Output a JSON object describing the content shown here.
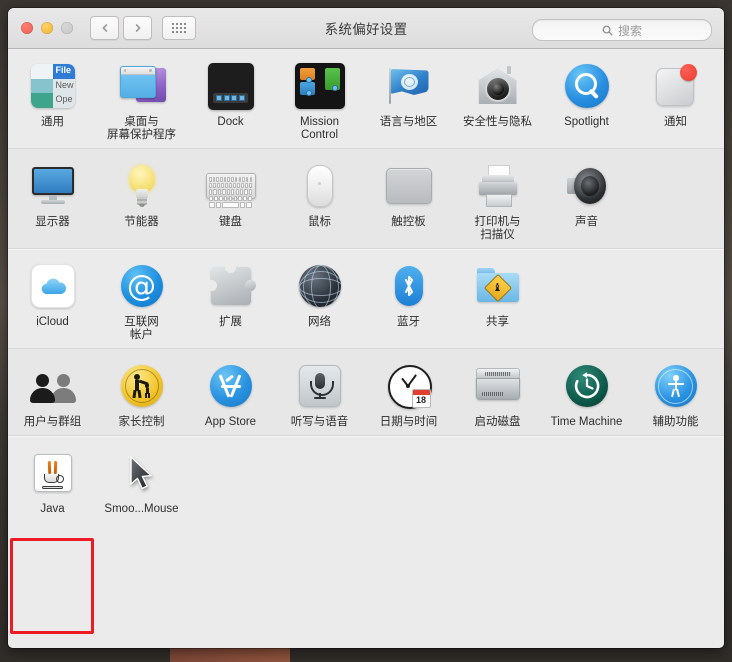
{
  "window": {
    "title": "系统偏好设置",
    "traffic_lights": [
      "close-red",
      "minimize-yellow",
      "zoom-gray-disabled"
    ],
    "back_label": "‹",
    "forward_label": "›",
    "show_all_label": "show-all-grid"
  },
  "search": {
    "placeholder": "搜索",
    "value": ""
  },
  "rows": [
    {
      "panes": [
        {
          "label": "通用",
          "icon": "general-icon",
          "general_text": {
            "file": "File",
            "new": "New",
            "open": "Ope"
          }
        },
        {
          "label": "桌面与\n屏幕保护程序",
          "icon": "desktop-screensaver-icon"
        },
        {
          "label": "Dock",
          "icon": "dock-icon"
        },
        {
          "label": "Mission\nControl",
          "icon": "mission-control-icon"
        },
        {
          "label": "语言与地区",
          "icon": "language-region-icon"
        },
        {
          "label": "安全性与隐私",
          "icon": "security-privacy-icon"
        },
        {
          "label": "Spotlight",
          "icon": "spotlight-icon"
        },
        {
          "label": "通知",
          "icon": "notifications-icon"
        }
      ]
    },
    {
      "panes": [
        {
          "label": "显示器",
          "icon": "displays-icon"
        },
        {
          "label": "节能器",
          "icon": "energy-saver-icon"
        },
        {
          "label": "键盘",
          "icon": "keyboard-icon"
        },
        {
          "label": "鼠标",
          "icon": "mouse-icon"
        },
        {
          "label": "触控板",
          "icon": "trackpad-icon"
        },
        {
          "label": "打印机与\n扫描仪",
          "icon": "printers-scanners-icon"
        },
        {
          "label": "声音",
          "icon": "sound-icon"
        }
      ]
    },
    {
      "panes": [
        {
          "label": "iCloud",
          "icon": "icloud-icon"
        },
        {
          "label": "互联网\n帐户",
          "icon": "internet-accounts-icon"
        },
        {
          "label": "扩展",
          "icon": "extensions-icon"
        },
        {
          "label": "网络",
          "icon": "network-icon"
        },
        {
          "label": "蓝牙",
          "icon": "bluetooth-icon"
        },
        {
          "label": "共享",
          "icon": "sharing-icon"
        }
      ]
    },
    {
      "panes": [
        {
          "label": "用户与群组",
          "icon": "users-groups-icon"
        },
        {
          "label": "家长控制",
          "icon": "parental-controls-icon"
        },
        {
          "label": "App Store",
          "icon": "app-store-icon"
        },
        {
          "label": "听写与语音",
          "icon": "dictation-speech-icon"
        },
        {
          "label": "日期与时间",
          "icon": "date-time-icon",
          "calendar_day": "18"
        },
        {
          "label": "启动磁盘",
          "icon": "startup-disk-icon"
        },
        {
          "label": "Time Machine",
          "icon": "time-machine-icon"
        },
        {
          "label": "辅助功能",
          "icon": "accessibility-icon"
        }
      ]
    },
    {
      "panes": [
        {
          "label": "Java",
          "icon": "java-icon"
        },
        {
          "label": "Smoo...Mouse",
          "icon": "smoothmouse-cursor-icon"
        }
      ]
    }
  ],
  "annotation": {
    "highlight_target": "Java",
    "color": "#ee1b24"
  },
  "colors": {
    "window_bg": "#ebebeb",
    "titlebar_top": "#e9e8e8",
    "titlebar_bottom": "#dedddd",
    "separator": "#d8d8d8",
    "label_text": "#2e2e2e",
    "placeholder_text": "#9b9b9b"
  }
}
